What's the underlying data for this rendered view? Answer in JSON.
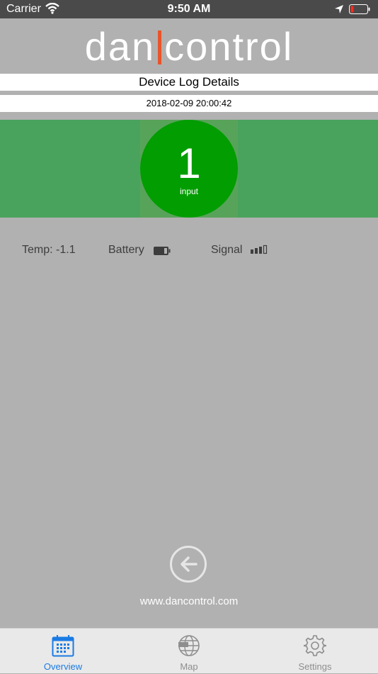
{
  "status_bar": {
    "carrier": "Carrier",
    "time": "9:50 AM"
  },
  "header": {
    "logo_left": "dan",
    "logo_right": "control",
    "title": "Device Log Details",
    "datetime": "2018-02-09 20:00:42"
  },
  "input_indicator": {
    "count": "1",
    "label": "input"
  },
  "stats": {
    "temp": "Temp: -1.1",
    "battery_label": "Battery",
    "signal_label": "Signal"
  },
  "footer": {
    "website": "www.dancontrol.com"
  },
  "tabs": [
    {
      "label": "Overview",
      "icon": "calendar-icon",
      "active": true
    },
    {
      "label": "Map",
      "icon": "globe-icon",
      "active": false
    },
    {
      "label": "Settings",
      "icon": "gear-icon",
      "active": false
    }
  ],
  "colors": {
    "background": "#b1b1b1",
    "status_bar": "#4a4a4a",
    "green_band": "#4aa35d",
    "circle": "#029d01",
    "logo_accent": "#e8552a",
    "tab_active": "#1a7be4",
    "tab_inactive": "#8e8e8e"
  }
}
